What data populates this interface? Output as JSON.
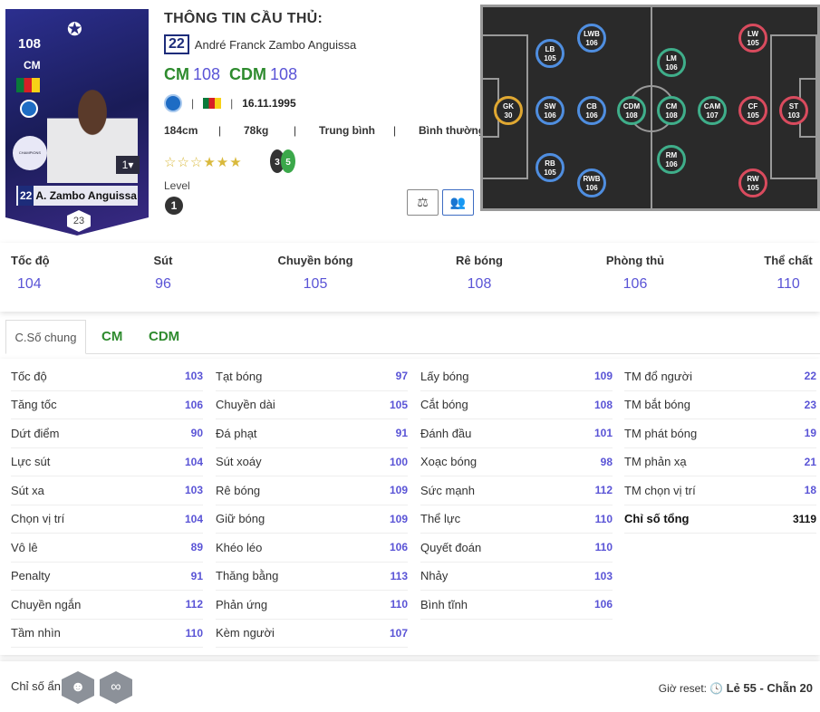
{
  "card": {
    "ovr": "108",
    "pos": "CM",
    "league": "CHAMPIONS LEAGUE",
    "level_badge": "1",
    "number": "22",
    "name": "A. Zambo Anguissa",
    "team_badge": "23"
  },
  "header": {
    "title": "THÔNG TIN CẦU THỦ:",
    "number": "22",
    "full_name": "André Franck Zambo Anguissa"
  },
  "positions": [
    {
      "pos": "CM",
      "val": "108"
    },
    {
      "pos": "CDM",
      "val": "108"
    }
  ],
  "meta": {
    "dob": "16.11.1995"
  },
  "physical": {
    "height": "184cm",
    "weight": "78kg",
    "build": "Trung bình",
    "skill": "Bình thường"
  },
  "skill_moves": "3",
  "weak_foot": "5",
  "level": {
    "label": "Level",
    "value": "1"
  },
  "pitch": [
    {
      "p": "LWB",
      "v": "106",
      "t": "def"
    },
    {
      "p": "LB",
      "v": "105",
      "t": "def"
    },
    {
      "p": "GK",
      "v": "30",
      "t": "gk"
    },
    {
      "p": "SW",
      "v": "106",
      "t": "def"
    },
    {
      "p": "CB",
      "v": "106",
      "t": "def"
    },
    {
      "p": "RB",
      "v": "105",
      "t": "def"
    },
    {
      "p": "RWB",
      "v": "106",
      "t": "def"
    },
    {
      "p": "LM",
      "v": "106",
      "t": "mid"
    },
    {
      "p": "CDM",
      "v": "108",
      "t": "mid"
    },
    {
      "p": "CM",
      "v": "108",
      "t": "mid"
    },
    {
      "p": "CAM",
      "v": "107",
      "t": "mid"
    },
    {
      "p": "RM",
      "v": "106",
      "t": "mid"
    },
    {
      "p": "LW",
      "v": "105",
      "t": "att"
    },
    {
      "p": "CF",
      "v": "105",
      "t": "att"
    },
    {
      "p": "ST",
      "v": "103",
      "t": "att"
    },
    {
      "p": "RW",
      "v": "105",
      "t": "att"
    }
  ],
  "summary": [
    {
      "k": "Tốc độ",
      "v": "104"
    },
    {
      "k": "Sút",
      "v": "96"
    },
    {
      "k": "Chuyền bóng",
      "v": "105"
    },
    {
      "k": "Rê bóng",
      "v": "108"
    },
    {
      "k": "Phòng thủ",
      "v": "106"
    },
    {
      "k": "Thể chất",
      "v": "110"
    }
  ],
  "tabs": [
    "C.Số chung",
    "CM",
    "CDM"
  ],
  "stats": [
    [
      [
        "Tốc độ",
        "103"
      ],
      [
        "Tăng tốc",
        "106"
      ],
      [
        "Dứt điểm",
        "90"
      ],
      [
        "Lực sút",
        "104"
      ],
      [
        "Sút xa",
        "103"
      ],
      [
        "Chọn vị trí",
        "104"
      ],
      [
        "Vô lê",
        "89"
      ],
      [
        "Penalty",
        "91"
      ],
      [
        "Chuyền ngắn",
        "112"
      ],
      [
        "Tầm nhìn",
        "110"
      ]
    ],
    [
      [
        "Tạt bóng",
        "97"
      ],
      [
        "Chuyền dài",
        "105"
      ],
      [
        "Đá phạt",
        "91"
      ],
      [
        "Sút xoáy",
        "100"
      ],
      [
        "Rê bóng",
        "109"
      ],
      [
        "Giữ bóng",
        "109"
      ],
      [
        "Khéo léo",
        "106"
      ],
      [
        "Thăng bằng",
        "113"
      ],
      [
        "Phản ứng",
        "110"
      ],
      [
        "Kèm người",
        "107"
      ]
    ],
    [
      [
        "Lấy bóng",
        "109"
      ],
      [
        "Cắt bóng",
        "108"
      ],
      [
        "Đánh đầu",
        "101"
      ],
      [
        "Xoạc bóng",
        "98"
      ],
      [
        "Sức mạnh",
        "112"
      ],
      [
        "Thể lực",
        "110"
      ],
      [
        "Quyết đoán",
        "110"
      ],
      [
        "Nhảy",
        "103"
      ],
      [
        "Bình tĩnh",
        "106"
      ]
    ],
    [
      [
        "TM đổ người",
        "22"
      ],
      [
        "TM bắt bóng",
        "23"
      ],
      [
        "TM phát bóng",
        "19"
      ],
      [
        "TM phản xạ",
        "21"
      ],
      [
        "TM chọn vị trí",
        "18"
      ],
      [
        "Chỉ số tổng",
        "3119"
      ]
    ]
  ],
  "footer": {
    "hidden_label": "Chỉ số ẩn:",
    "reset_label": "Giờ reset:",
    "reset_value": "Lẻ 55 - Chẵn 20"
  }
}
